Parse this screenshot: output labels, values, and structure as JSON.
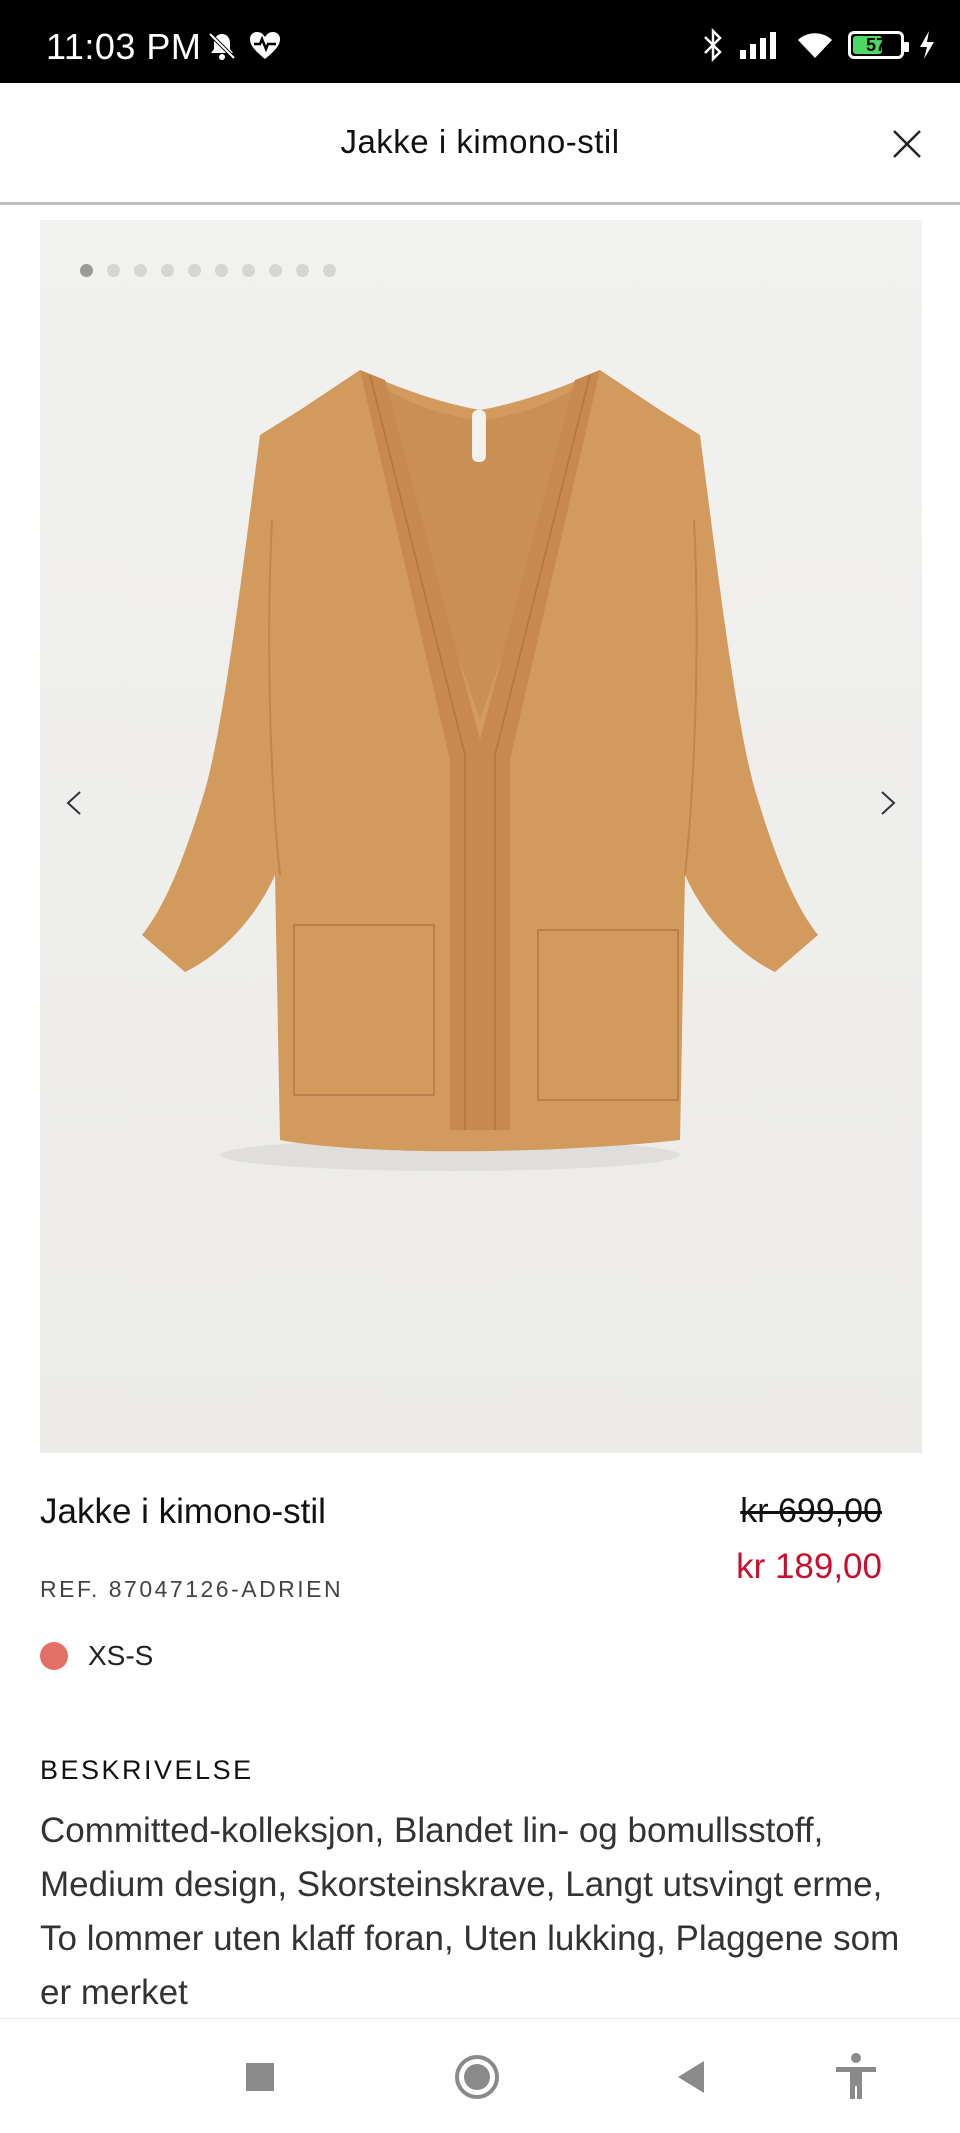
{
  "status_bar": {
    "time": "11:03 PM",
    "battery_level": "57",
    "icons": [
      "mute-bell-icon",
      "heart-pulse-icon",
      "bluetooth-icon",
      "signal-icon",
      "wifi-icon",
      "battery-icon",
      "charging-icon"
    ]
  },
  "header": {
    "title": "Jakke i kimono-stil",
    "close_icon": "close-icon"
  },
  "gallery": {
    "image_count": 10,
    "active_index": 0,
    "prev_icon": "chevron-left-icon",
    "next_icon": "chevron-right-icon",
    "image_subject": "kimono jacket",
    "garment_color": "#d39a5e"
  },
  "product": {
    "name": "Jakke i kimono-stil",
    "ref": "REF. 87047126-ADRIEN",
    "price_old": "kr 699,00",
    "price_new": "kr 189,00",
    "price_new_color": "#c8102e",
    "color_swatch": "#e46f66",
    "size": "XS-S"
  },
  "description": {
    "heading": "BESKRIVELSE",
    "text": "Committed-kolleksjon, Blandet lin- og bomullsstoff, Medium design, Skorsteinskrave, Langt utsvingt erme, To lommer uten klaff foran, Uten lukking, Plaggene som er merket"
  },
  "nav_bar": {
    "buttons": [
      "recents-square-icon",
      "home-circle-icon",
      "back-triangle-icon",
      "accessibility-icon"
    ]
  }
}
